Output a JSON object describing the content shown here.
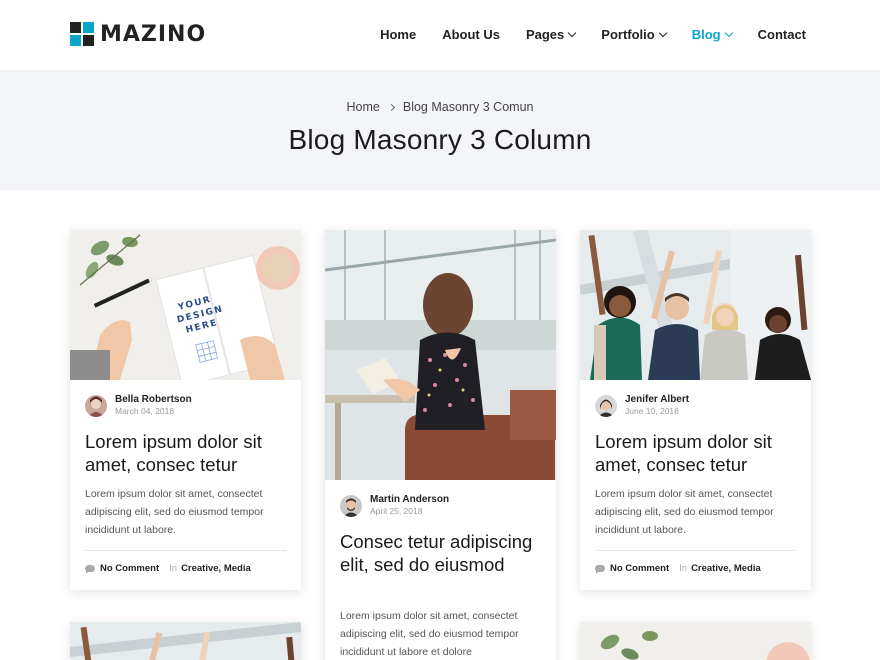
{
  "brand": {
    "name": "MAZINO"
  },
  "nav": {
    "items": [
      {
        "label": "Home",
        "has_dropdown": false,
        "active": false
      },
      {
        "label": "About Us",
        "has_dropdown": false,
        "active": false
      },
      {
        "label": "Pages",
        "has_dropdown": true,
        "active": false
      },
      {
        "label": "Portfolio",
        "has_dropdown": true,
        "active": false
      },
      {
        "label": "Blog",
        "has_dropdown": true,
        "active": true
      },
      {
        "label": "Contact",
        "has_dropdown": false,
        "active": false
      }
    ]
  },
  "colors": {
    "accent": "#0aa6c9",
    "banner_bg": "#f3f5f8",
    "text_dark": "#222222"
  },
  "banner": {
    "breadcrumb": {
      "home": "Home",
      "current": "Blog Masonry 3 Comun"
    },
    "title": "Blog Masonry 3 Column"
  },
  "posts": [
    {
      "image_icon": "notebook-design-image",
      "author": "Bella Robertson",
      "date": "March 04, 2018",
      "title": "Lorem ipsum dolor sit amet, consec tetur",
      "excerpt": "Lorem ipsum dolor sit amet, consectet adipiscing elit, sed do eiusmod tempor incididunt ut labore.",
      "comments": "No Comment",
      "in_label": "In",
      "categories": "Creative, Media"
    },
    {
      "image_icon": "woman-reading-image",
      "author": "Martin Anderson",
      "date": "April 25, 2018",
      "title": "Consec tetur adipiscing elit, sed do eiusmod",
      "excerpt": "Lorem ipsum dolor sit amet, consectet adipiscing elit, sed do eiusmod tempor  incididunt ut labore et dolore"
    },
    {
      "image_icon": "team-celebrating-image",
      "author": "Jenifer Albert",
      "date": "June 10, 2018",
      "title": "Lorem ipsum dolor sit amet, consec tetur",
      "excerpt": "Lorem ipsum dolor sit amet, consectet adipiscing elit, sed do eiusmod tempor incididunt ut labore.",
      "comments": "No Comment",
      "in_label": "In",
      "categories": "Creative, Media"
    }
  ]
}
